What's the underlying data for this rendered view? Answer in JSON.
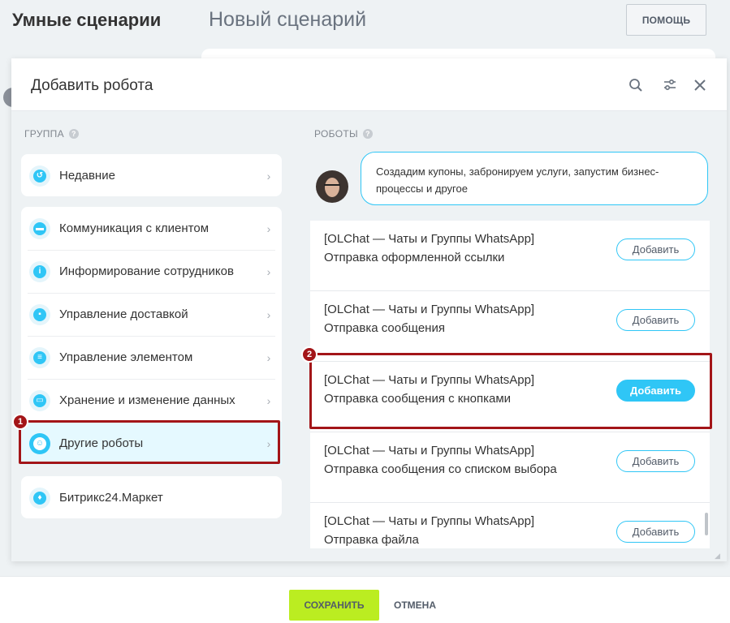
{
  "page": {
    "title": "Умные сценарии",
    "subtitle": "Новый сценарий",
    "help_label": "ПОМОЩЬ"
  },
  "panel": {
    "title": "Добавить робота",
    "icons": [
      "search-icon",
      "settings-sliders-icon",
      "close-icon"
    ]
  },
  "groups": {
    "label": "ГРУППА",
    "recent": {
      "label": "Недавние",
      "icon": "recent-clock-icon"
    },
    "items": [
      {
        "label": "Коммуникация с клиентом",
        "icon": "chat-icon"
      },
      {
        "label": "Информирование сотрудников",
        "icon": "info-icon"
      },
      {
        "label": "Управление доставкой",
        "icon": "truck-icon"
      },
      {
        "label": "Управление элементом",
        "icon": "filter-icon"
      },
      {
        "label": "Хранение и изменение данных",
        "icon": "storage-icon"
      },
      {
        "label": "Другие роботы",
        "icon": "robot-icon",
        "active": true
      }
    ],
    "market": {
      "label": "Битрикс24.Маркет",
      "icon": "market-bag-icon"
    }
  },
  "robots": {
    "label": "РОБОТЫ",
    "bubble_text": "Создадим купоны, забронируем услуги, запустим бизнес-процессы и другое",
    "add_label": "Добавить",
    "items": [
      {
        "title": "[OLChat — Чаты и Группы WhatsApp]",
        "subtitle": "Отправка оформленной ссылки"
      },
      {
        "title": "[OLChat — Чаты и Группы WhatsApp]",
        "subtitle": "Отправка сообщения"
      },
      {
        "title": "[OLChat — Чаты и Группы WhatsApp]",
        "subtitle": "Отправка сообщения с кнопками",
        "highlighted": true
      },
      {
        "title": "[OLChat — Чаты и Группы WhatsApp]",
        "subtitle": "Отправка сообщения со списком выбора"
      },
      {
        "title": "[OLChat — Чаты и Группы WhatsApp]",
        "subtitle": "Отправка файла"
      }
    ]
  },
  "annotations": {
    "step1": "1",
    "step2": "2"
  },
  "footer": {
    "save_label": "СОХРАНИТЬ",
    "cancel_label": "ОТМЕНА"
  },
  "colors": {
    "accent": "#2fc6f6",
    "save": "#bbed21",
    "highlight": "#a31518"
  }
}
